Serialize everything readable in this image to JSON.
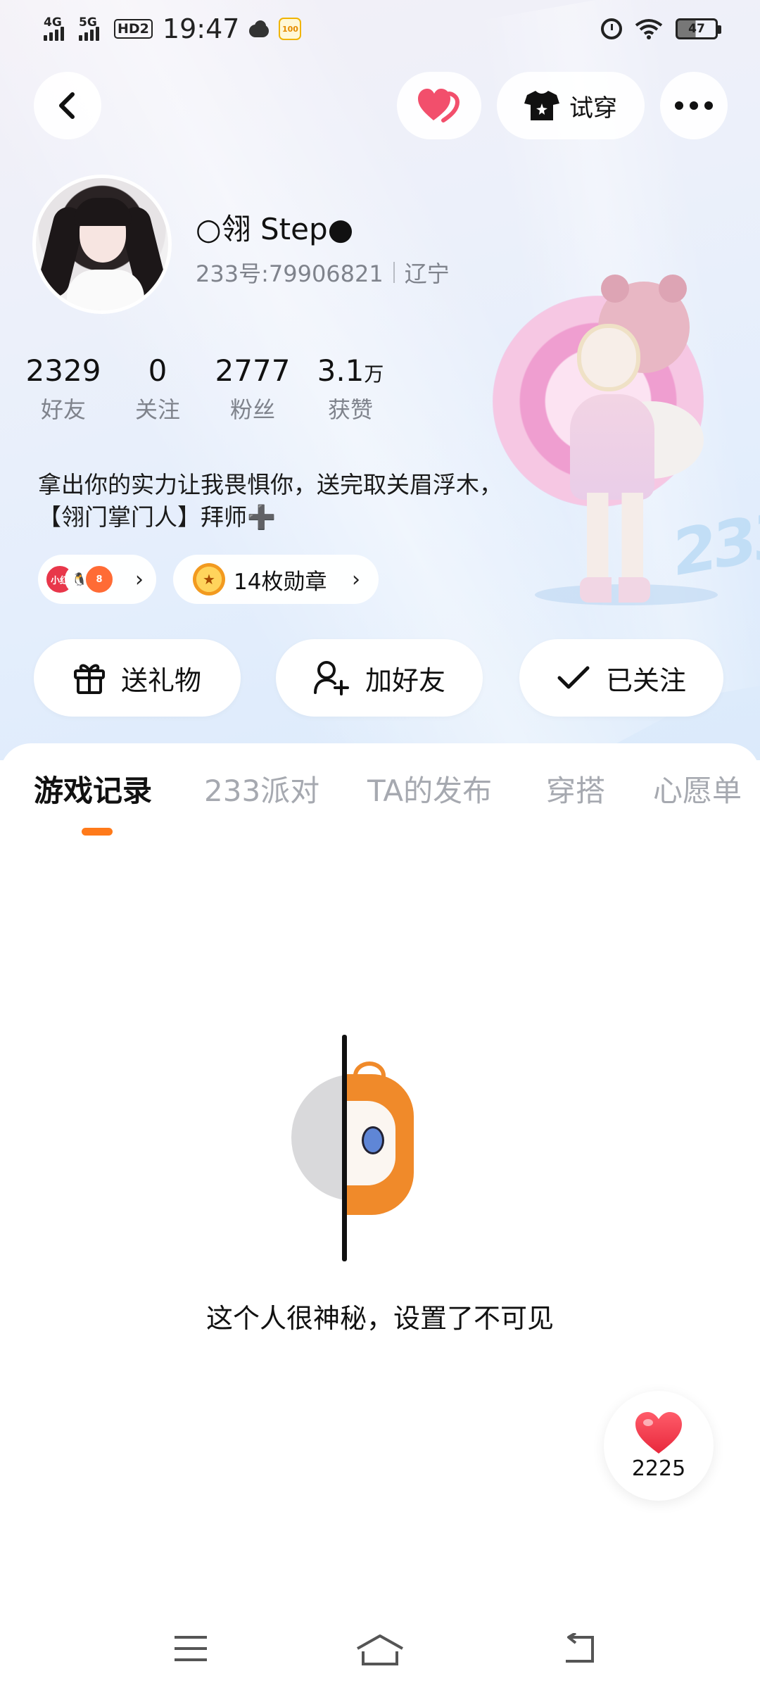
{
  "status_bar": {
    "signal1": "4G",
    "signal2": "5G",
    "hd": "HD2",
    "time": "19:47",
    "app_badge": "100",
    "battery": "47"
  },
  "top_nav": {
    "tryon_label": "试穿"
  },
  "profile": {
    "username": "○翎 Step●",
    "user_id": "233号:79906821",
    "location": "辽宁",
    "stats": [
      {
        "num": "2329",
        "unit": "",
        "label": "好友"
      },
      {
        "num": "0",
        "unit": "",
        "label": "关注"
      },
      {
        "num": "2777",
        "unit": "",
        "label": "粉丝"
      },
      {
        "num": "3.1",
        "unit": "万",
        "label": "获赞"
      }
    ],
    "bio": "拿出你的实力让我畏惧你，送完取关眉浮木，【翎门掌门人】拜师➕",
    "social_icons": [
      "小红",
      "🐧",
      "8"
    ],
    "medals": "14枚勋章"
  },
  "actions": {
    "gift": "送礼物",
    "add_friend": "加好友",
    "followed": "已关注"
  },
  "tabs": [
    "游戏记录",
    "233派对",
    "TA的发布",
    "穿搭",
    "心愿单"
  ],
  "empty": {
    "text": "这个人很神秘，设置了不可见"
  },
  "likes": {
    "count": "2225"
  },
  "colors": {
    "accent": "#ff7a1a",
    "heart": "#f0455c"
  }
}
